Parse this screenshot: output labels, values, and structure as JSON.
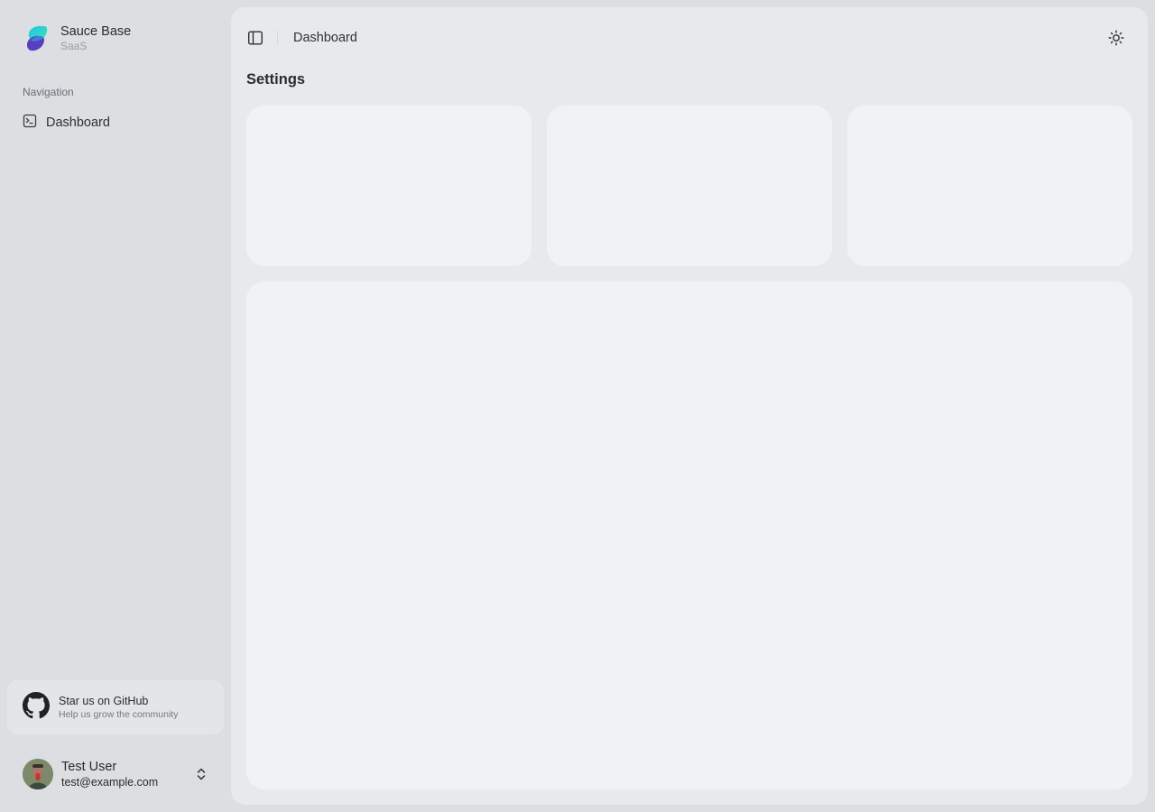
{
  "brand": {
    "name": "Sauce Base",
    "subtitle": "SaaS"
  },
  "sidebar": {
    "nav_heading": "Navigation",
    "items": [
      {
        "label": "Dashboard",
        "icon": "terminal-square-icon"
      }
    ]
  },
  "github_card": {
    "title": "Star us on GitHub",
    "subtitle": "Help us grow the community",
    "icon": "github-icon"
  },
  "user": {
    "name": "Test User",
    "email": "test@example.com"
  },
  "header": {
    "breadcrumb": "Dashboard",
    "toggle_icon": "panel-left-icon",
    "theme_icon": "sun-icon"
  },
  "main": {
    "title": "Settings"
  },
  "colors": {
    "brand_teal": "#2fd1c8",
    "brand_purple": "#5b3fbf",
    "background": "#dcdee2",
    "panel": "#e7eaed",
    "card": "#f0f2f4"
  }
}
